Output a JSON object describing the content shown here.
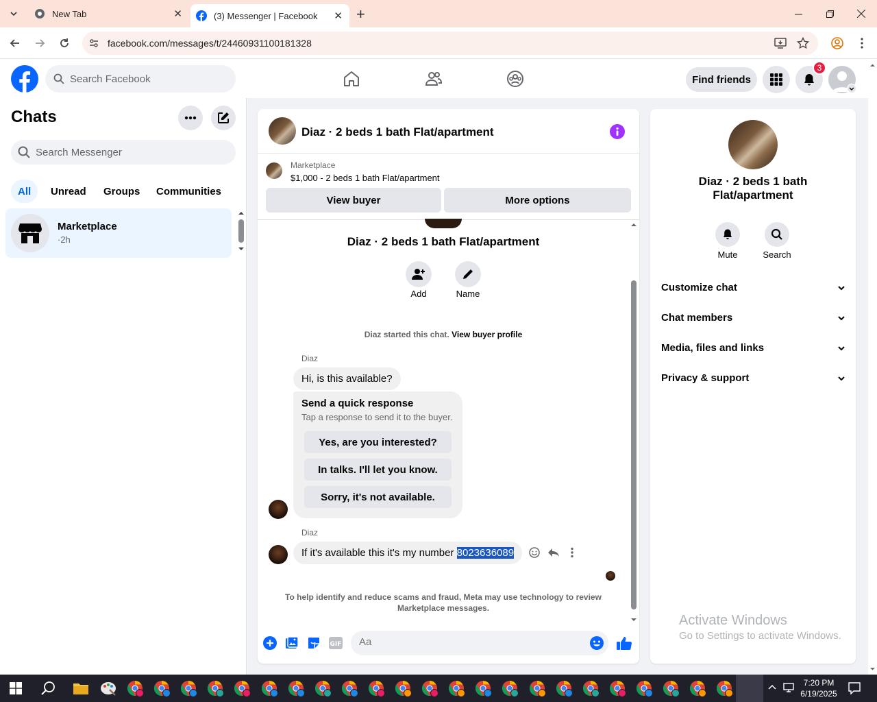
{
  "browser": {
    "tabs": [
      {
        "title": "New Tab"
      },
      {
        "title": "(3) Messenger | Facebook"
      }
    ],
    "url": "facebook.com/messages/t/24460931100181328"
  },
  "fb": {
    "search_placeholder": "Search Facebook",
    "find_friends": "Find friends",
    "notification_count": "3"
  },
  "sidebar": {
    "title": "Chats",
    "search_placeholder": "Search Messenger",
    "filters": [
      "All",
      "Unread",
      "Groups",
      "Communities"
    ],
    "chat_item": {
      "name": "Marketplace",
      "time": "·2h"
    }
  },
  "chat": {
    "header_title": "Diaz · 2 beds 1 bath Flat/apartment",
    "listing_source": "Marketplace",
    "listing_desc": "$1,000 - 2 beds 1 bath Flat/apartment",
    "view_buyer": "View buyer",
    "more_options": "More options",
    "profile_title": "Diaz · 2 beds 1 bath Flat/apartment",
    "add_label": "Add",
    "name_label": "Name",
    "started_text": "Diaz started this chat.",
    "view_buyer_profile": "View buyer profile",
    "sender1": "Diaz",
    "msg1": "Hi, is this available?",
    "quick_title": "Send a quick response",
    "quick_sub": "Tap a response to send it to the buyer.",
    "quick_options": [
      "Yes, are you interested?",
      "In talks. I'll let you know.",
      "Sorry, it's not available."
    ],
    "sender2": "Diaz",
    "msg2_prefix": "If it's available this it's my number ",
    "msg2_number": "8023636089",
    "disclaimer": "To help identify and reduce scams and fraud, Meta may use technology to review Marketplace messages.",
    "composer_placeholder": "Aa"
  },
  "right": {
    "title": "Diaz · 2 beds 1 bath Flat/apartment",
    "mute": "Mute",
    "search": "Search",
    "sections": [
      "Customize chat",
      "Chat members",
      "Media, files and links",
      "Privacy & support"
    ]
  },
  "watermark": {
    "line1": "Activate Windows",
    "line2": "Go to Settings to activate Windows."
  },
  "taskbar": {
    "time": "7:20 PM",
    "date": "6/19/2025"
  },
  "colors": {
    "fb_blue": "#0866ff",
    "messenger_purple": "#a033ff",
    "badge_red": "#e41e3f",
    "selection_blue": "#1a57c4"
  }
}
